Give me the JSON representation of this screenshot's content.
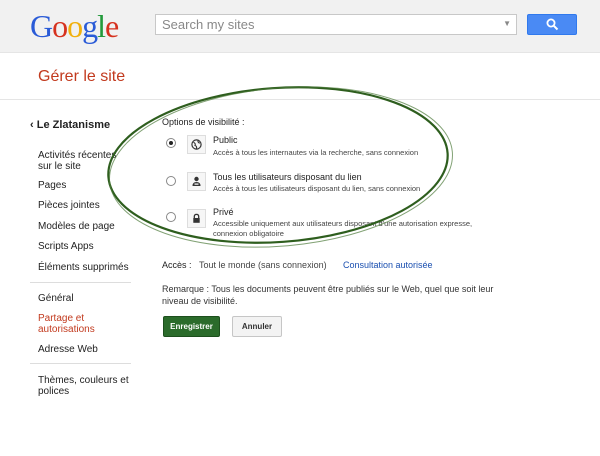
{
  "header": {
    "logo_text": "Google",
    "search_placeholder": "Search my sites"
  },
  "page_title": "Gérer le site",
  "sidebar": {
    "back_label": "Le Zlatanisme",
    "items": [
      {
        "label": "Activités récentes sur le site"
      },
      {
        "label": "Pages"
      },
      {
        "label": "Pièces jointes"
      },
      {
        "label": "Modèles de page"
      },
      {
        "label": "Scripts Apps"
      },
      {
        "label": "Éléments supprimés"
      },
      {
        "label": "Général"
      },
      {
        "label": "Partage et autorisations"
      },
      {
        "label": "Adresse Web"
      },
      {
        "label": "Thèmes, couleurs et polices"
      }
    ]
  },
  "visibility": {
    "title": "Options de visibilité :",
    "options": [
      {
        "name": "Public",
        "description": "Accès à tous les internautes via la recherche, sans connexion",
        "selected": true,
        "icon": "globe-icon"
      },
      {
        "name": "Tous les utilisateurs disposant du lien",
        "description": "Accès à tous les utilisateurs disposant du lien, sans connexion",
        "selected": false,
        "icon": "person-link-icon"
      },
      {
        "name": "Privé",
        "description": "Accessible uniquement aux utilisateurs disposant d'une autorisation expresse, connexion obligatoire",
        "selected": false,
        "icon": "lock-icon"
      }
    ]
  },
  "access": {
    "label": "Accès :",
    "value": "Tout le monde (sans connexion)",
    "link": "Consultation autorisée"
  },
  "remark": "Remarque : Tous les documents peuvent être publiés sur le Web, quel que soit leur niveau de visibilité.",
  "buttons": {
    "save": "Enregistrer",
    "cancel": "Annuler"
  },
  "colors": {
    "accent_red": "#c23a1e",
    "save_green": "#2b6b2b",
    "link_blue": "#1a4fb0",
    "annotation_green": "#2e5e1e"
  }
}
